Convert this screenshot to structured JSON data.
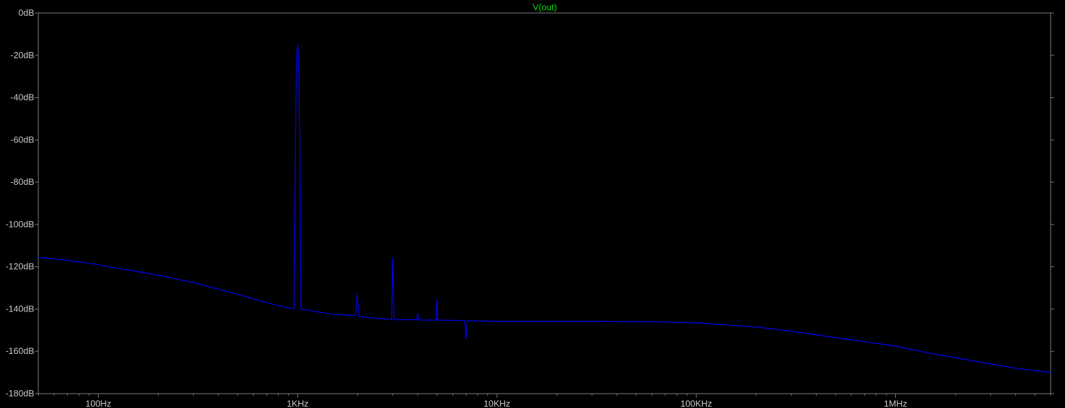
{
  "chart_data": {
    "type": "line",
    "title": "V(out)",
    "title_color": "#00e000",
    "trace_color": "#0000ff",
    "frame_color": "#808080",
    "background_color": "#000000",
    "grid": false,
    "x_scale": "log",
    "xlim": [
      50,
      6000000
    ],
    "ylim": [
      -180,
      0
    ],
    "x_ticks": [
      {
        "value": 100,
        "label": "100Hz"
      },
      {
        "value": 1000,
        "label": "1KHz"
      },
      {
        "value": 10000,
        "label": "10KHz"
      },
      {
        "value": 100000,
        "label": "100KHz"
      },
      {
        "value": 1000000,
        "label": "1MHz"
      }
    ],
    "y_ticks": [
      {
        "value": 0,
        "label": "0dB"
      },
      {
        "value": -20,
        "label": "-20dB"
      },
      {
        "value": -40,
        "label": "-40dB"
      },
      {
        "value": -60,
        "label": "-60dB"
      },
      {
        "value": -80,
        "label": "-80dB"
      },
      {
        "value": -100,
        "label": "-100dB"
      },
      {
        "value": -120,
        "label": "-120dB"
      },
      {
        "value": -140,
        "label": "-140dB"
      },
      {
        "value": -160,
        "label": "-160dB"
      },
      {
        "value": -180,
        "label": "-180dB"
      }
    ],
    "series": [
      {
        "name": "V(out)",
        "points": [
          [
            50,
            -115.5
          ],
          [
            70,
            -117
          ],
          [
            100,
            -119
          ],
          [
            120,
            -120.5
          ],
          [
            150,
            -122
          ],
          [
            200,
            -124
          ],
          [
            300,
            -127.5
          ],
          [
            500,
            -133
          ],
          [
            700,
            -137
          ],
          [
            900,
            -139.5
          ],
          [
            960,
            -139.8
          ],
          [
            975,
            -60
          ],
          [
            985,
            -28
          ],
          [
            993,
            -18
          ],
          [
            1000,
            -15
          ],
          [
            1007,
            -18
          ],
          [
            1015,
            -28
          ],
          [
            1025,
            -60
          ],
          [
            1040,
            -140
          ],
          [
            1200,
            -141
          ],
          [
            1500,
            -142.5
          ],
          [
            1950,
            -143
          ],
          [
            1990,
            -133
          ],
          [
            2030,
            -143.5
          ],
          [
            2500,
            -144.5
          ],
          [
            2960,
            -144.8
          ],
          [
            3000,
            -116
          ],
          [
            3040,
            -145
          ],
          [
            3500,
            -145
          ],
          [
            3960,
            -145
          ],
          [
            4000,
            -142
          ],
          [
            4050,
            -145.2
          ],
          [
            4950,
            -145.2
          ],
          [
            5000,
            -135.5
          ],
          [
            5050,
            -145.2
          ],
          [
            6900,
            -145.5
          ],
          [
            7000,
            -154
          ],
          [
            7100,
            -145.5
          ],
          [
            10000,
            -145.8
          ],
          [
            30000,
            -145.8
          ],
          [
            60000,
            -146
          ],
          [
            100000,
            -146.5
          ],
          [
            200000,
            -148.5
          ],
          [
            300000,
            -150.5
          ],
          [
            500000,
            -153.5
          ],
          [
            1000000,
            -157.5
          ],
          [
            1500000,
            -161
          ],
          [
            2000000,
            -163
          ],
          [
            3000000,
            -166
          ],
          [
            4000000,
            -168
          ],
          [
            6000000,
            -170
          ]
        ]
      }
    ]
  }
}
